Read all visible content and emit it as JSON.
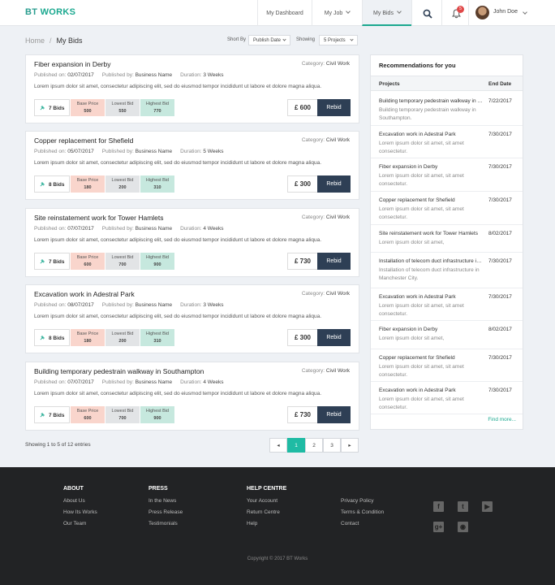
{
  "brand": {
    "part1": "BT",
    "part2": "WORKS"
  },
  "nav": {
    "items": [
      {
        "label": "My Dashboard"
      },
      {
        "label": "My Job"
      },
      {
        "label": "My Bids"
      }
    ]
  },
  "notifications": {
    "count": "5"
  },
  "user": {
    "name": "John Doe"
  },
  "breadcrumb": {
    "home": "Home",
    "separator": "/",
    "current": "My Bids"
  },
  "controls": {
    "sort_label": "Short By",
    "sort_value": "Publish Date",
    "showing_label": "Showing",
    "showing_value": "5 Projects"
  },
  "bid_labels": {
    "published_on": "Published on:",
    "published_by": "Published by:",
    "duration": "Duration:",
    "category": "Category:",
    "base": "Base Price",
    "lowest": "Lowest Bid",
    "highest": "Highest Bid",
    "rebid": "Rebid"
  },
  "bids": [
    {
      "title": "Fiber expansion in  Derby",
      "category": "Civil Work",
      "published_on": "02/07/2017",
      "published_by": "Business Name",
      "duration": "3 Weeks",
      "description": "Lorem ipsum dolor sit amet, consectetur adipiscing elit, sed do eiusmod tempor incididunt ut labore et dolore magna aliqua.",
      "bids_count": "7 Bids",
      "base": "500",
      "lowest": "550",
      "highest": "770",
      "amount": "£ 600"
    },
    {
      "title": "Copper replacement for Shefield",
      "category": "Civil Work",
      "published_on": "05/07/2017",
      "published_by": "Business Name",
      "duration": "5 Weeks",
      "description": "Lorem ipsum dolor sit amet, consectetur adipiscing elit, sed do eiusmod tempor incididunt ut labore et dolore magna aliqua.",
      "bids_count": "8 Bids",
      "base": "180",
      "lowest": "200",
      "highest": "310",
      "amount": "£ 300"
    },
    {
      "title": "Site reinstatement work for Tower Hamlets",
      "category": "Civil Work",
      "published_on": "07/07/2017",
      "published_by": "Business Name",
      "duration": "4 Weeks",
      "description": "Lorem ipsum dolor sit amet, consectetur adipiscing elit, sed do eiusmod tempor incididunt ut labore et dolore magna aliqua.",
      "bids_count": "7 Bids",
      "base": "600",
      "lowest": "700",
      "highest": "900",
      "amount": "£ 730"
    },
    {
      "title": "Excavation work in Adestral Park",
      "category": "Civil Work",
      "published_on": "08/07/2017",
      "published_by": "Business Name",
      "duration": "3 Weeks",
      "description": "Lorem ipsum dolor sit amet, consectetur adipiscing elit, sed do eiusmod tempor incididunt ut labore et dolore magna aliqua.",
      "bids_count": "8 Bids",
      "base": "180",
      "lowest": "200",
      "highest": "310",
      "amount": "£ 300"
    },
    {
      "title": "Building temporary pedestrain walkway in Southampton",
      "category": "Civil Work",
      "published_on": "07/07/2017",
      "published_by": "Business Name",
      "duration": "4 Weeks",
      "description": "Lorem ipsum dolor sit amet, consectetur adipiscing elit, sed do eiusmod tempor incididunt ut labore et dolore magna aliqua.",
      "bids_count": "7 Bids",
      "base": "600",
      "lowest": "700",
      "highest": "900",
      "amount": "£ 730"
    }
  ],
  "pagination": {
    "summary": "Showing 1 to 5 of 12 entries",
    "prev": "◂",
    "pages": [
      "1",
      "2",
      "3"
    ],
    "next": "▸"
  },
  "recommendations": {
    "title": "Recommendations for you",
    "col_projects": "Projects",
    "col_end_date": "End Date",
    "items": [
      {
        "title": "Building temporary pedestrain walkway in Southampton",
        "sub": "Building temporary pedestrain walkway in Southampton.",
        "date": "7/22/2017"
      },
      {
        "title": "Excavation work in Adestral Park",
        "sub": "Lorem ipsum dolor sit amet, sit amet consectetur.",
        "date": "7/30/2017"
      },
      {
        "title": "Fiber expansion in  Derby",
        "sub": "Lorem ipsum dolor sit amet, sit amet consectetur.",
        "date": "7/30/2017"
      },
      {
        "title": "Copper replacement for Shefield",
        "sub": "Lorem ipsum dolor sit amet, sit amet consectetur.",
        "date": "7/30/2017"
      },
      {
        "title": "Site reinstatement work for Tower Hamlets",
        "sub": "Lorem ipsum dolor sit amet,",
        "date": "8/02/2017"
      },
      {
        "title": "Installation of telecom duct infrastructure in Manchester City",
        "sub": "Installation of telecom duct infrastructure in Manchester City.",
        "date": "7/30/2017"
      },
      {
        "title": "Excavation work in Adestral Park",
        "sub": "Lorem ipsum dolor sit amet, sit amet consectetur.",
        "date": "7/30/2017"
      },
      {
        "title": "Fiber expansion in  Derby",
        "sub": "Lorem ipsum dolor sit amet,",
        "date": "8/02/2017"
      },
      {
        "title": "Copper replacement for Shefield",
        "sub": "Lorem ipsum dolor sit amet, sit amet consectetur.",
        "date": "7/30/2017"
      },
      {
        "title": "Excavation work in Adestral Park",
        "sub": "Lorem ipsum dolor sit amet, sit amet consectetur.",
        "date": "7/30/2017"
      }
    ],
    "find_more": "Find more..."
  },
  "footer": {
    "columns": [
      {
        "heading": "ABOUT",
        "links": [
          "About Us",
          "How Its Works",
          "Our Team"
        ]
      },
      {
        "heading": "PRESS",
        "links": [
          "In the News",
          "Press Release",
          "Testimonials"
        ]
      },
      {
        "heading": "HELP CENTRE",
        "links": [
          "Your Account",
          "Return Centre",
          "Help"
        ]
      },
      {
        "heading": "",
        "links": [
          "Privacy Policy",
          "Terms & Condition",
          "Contact"
        ]
      }
    ],
    "social": [
      "facebook-icon",
      "twitter-icon",
      "youtube-icon",
      "google-plus-icon",
      "rss-icon"
    ],
    "copyright": "Copyright © 2017 BT Works"
  },
  "colors": {
    "accent": "#1aa88f",
    "dark_button": "#2e3f55",
    "base_bg": "#f9d5cc",
    "low_bg": "#e2e4e6",
    "high_bg": "#c6e8de",
    "footer_bg": "#222325"
  }
}
